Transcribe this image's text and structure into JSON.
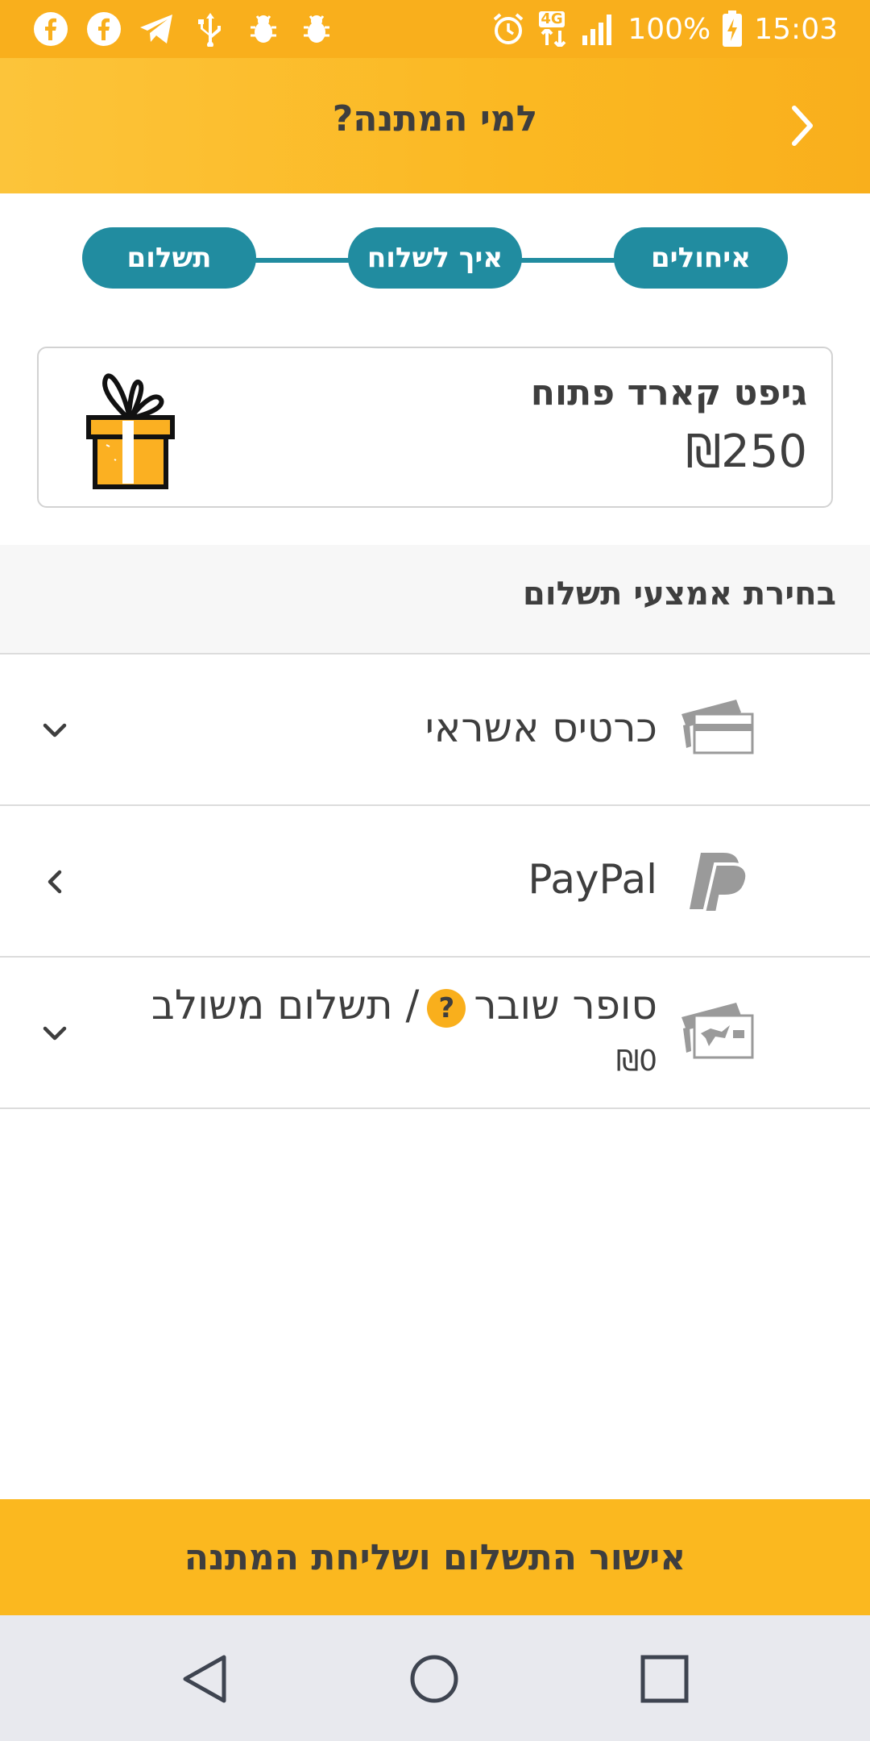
{
  "status_bar": {
    "left_icons": [
      "facebook-icon",
      "facebook-icon",
      "telegram-icon",
      "usb-icon",
      "bug-icon",
      "bug-icon"
    ],
    "network": "4G",
    "battery": "100%",
    "time": "15:03"
  },
  "header": {
    "title": "למי המתנה?",
    "back_icon": "chevron-right-icon"
  },
  "stepper": {
    "steps": [
      {
        "label": "איחולים"
      },
      {
        "label": "איך לשלוח"
      },
      {
        "label": "תשלום"
      }
    ]
  },
  "gift_card": {
    "name": "גיפט קארד פתוח",
    "price": "₪250",
    "icon": "gift-box-icon"
  },
  "payment_section": {
    "title": "בחירת אמצעי תשלום",
    "methods": [
      {
        "label": "כרטיס אשראי",
        "icon": "credit-card-icon",
        "chevron": "chevron-down-icon"
      },
      {
        "label": "PayPal",
        "icon": "paypal-icon",
        "chevron": "chevron-left-icon"
      },
      {
        "label_main": "סופר שובר",
        "help": "?",
        "label_rest": "/ תשלום משולב",
        "amount": "₪0",
        "icon": "voucher-card-icon",
        "chevron": "chevron-down-icon"
      }
    ]
  },
  "confirm": {
    "label": "אישור התשלום ושליחת המתנה"
  },
  "nav_bar": {
    "buttons": [
      "back-triangle-icon",
      "home-circle-icon",
      "recents-square-icon"
    ]
  },
  "colors": {
    "accent": "#f9af1c",
    "teal": "#218ca0",
    "text": "#3e3e3e"
  }
}
